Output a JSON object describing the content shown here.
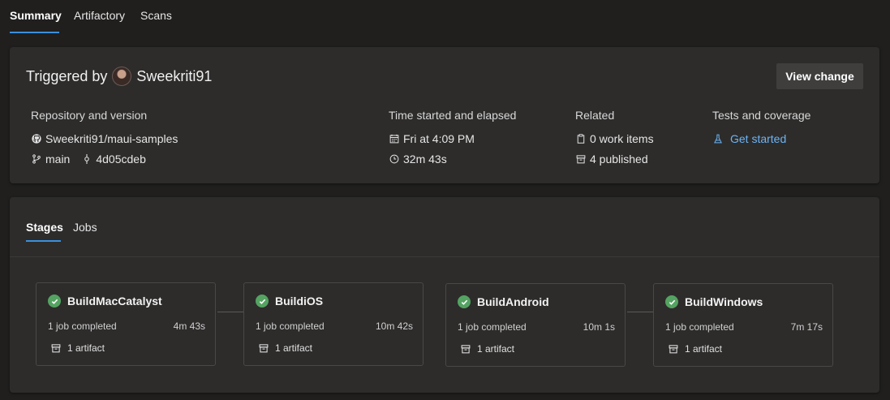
{
  "top_tabs": [
    {
      "label": "Summary",
      "active": true
    },
    {
      "label": "Artifactory",
      "active": false
    },
    {
      "label": "Scans",
      "active": false
    }
  ],
  "run": {
    "triggered_label": "Triggered by",
    "user": "Sweekriti91",
    "view_change_label": "View change"
  },
  "repository": {
    "title": "Repository and version",
    "repo": "Sweekriti91/maui-samples",
    "branch": "main",
    "commit": "4d05cdeb"
  },
  "time": {
    "title": "Time started and elapsed",
    "started": "Fri at 4:09 PM",
    "elapsed": "32m 43s"
  },
  "related": {
    "title": "Related",
    "work_items": "0 work items",
    "published": "4 published"
  },
  "tests": {
    "title": "Tests and coverage",
    "link": "Get started"
  },
  "stage_tabs": [
    {
      "label": "Stages",
      "active": true
    },
    {
      "label": "Jobs",
      "active": false
    }
  ],
  "stages": [
    {
      "name": "BuildMacCatalyst",
      "jobs": "1 job completed",
      "duration": "4m 43s",
      "artifacts": "1 artifact",
      "status": "succeeded"
    },
    {
      "name": "BuildiOS",
      "jobs": "1 job completed",
      "duration": "10m 42s",
      "artifacts": "1 artifact",
      "status": "succeeded"
    },
    {
      "name": "BuildAndroid",
      "jobs": "1 job completed",
      "duration": "10m 1s",
      "artifacts": "1 artifact",
      "status": "succeeded"
    },
    {
      "name": "BuildWindows",
      "jobs": "1 job completed",
      "duration": "7m 17s",
      "artifacts": "1 artifact",
      "status": "succeeded"
    }
  ],
  "colors": {
    "accent": "#3b8fdc",
    "success": "#55a362",
    "link": "#6cb4f5"
  }
}
